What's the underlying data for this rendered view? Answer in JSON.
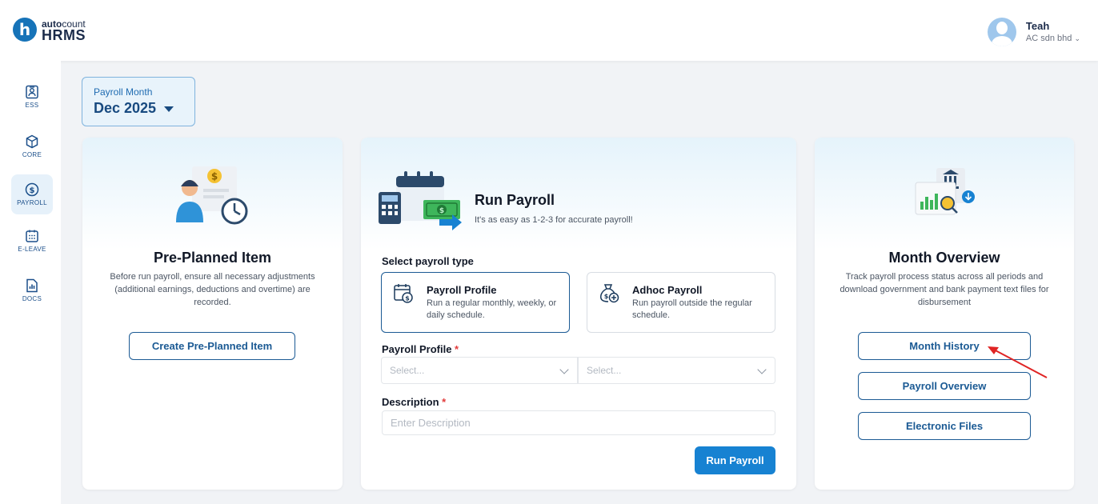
{
  "header": {
    "logo_letter": "h",
    "logo_brand_bold": "auto",
    "logo_brand_thin": "count",
    "logo_product": "HRMS",
    "user_name": "Teah",
    "user_company": "AC sdn bhd"
  },
  "sidebar": {
    "items": [
      {
        "label": "ESS",
        "icon": "person-card-icon"
      },
      {
        "label": "CORE",
        "icon": "cube-icon"
      },
      {
        "label": "PAYROLL",
        "icon": "dollar-circle-icon",
        "active": true
      },
      {
        "label": "E-LEAVE",
        "icon": "calendar-icon"
      },
      {
        "label": "DOCS",
        "icon": "document-chart-icon"
      }
    ]
  },
  "payroll_month": {
    "label": "Payroll Month",
    "value": "Dec 2025"
  },
  "pre_planned": {
    "title": "Pre-Planned Item",
    "description": "Before run payroll, ensure all necessary adjustments (additional earnings, deductions and overtime) are recorded.",
    "button": "Create Pre-Planned Item"
  },
  "run_payroll": {
    "title": "Run Payroll",
    "subtitle": "It's as easy as 1-2-3 for accurate payroll!",
    "select_type_label": "Select payroll type",
    "types": [
      {
        "title": "Payroll Profile",
        "description": "Run a regular monthly, weekly, or daily schedule.",
        "selected": true
      },
      {
        "title": "Adhoc Payroll",
        "description": "Run payroll outside the regular schedule.",
        "selected": false
      }
    ],
    "profile_label": "Payroll Profile",
    "required_mark": "*",
    "select_placeholder_1": "Select...",
    "select_placeholder_2": "Select...",
    "description_label": "Description",
    "description_placeholder": "Enter Description",
    "button": "Run Payroll"
  },
  "month_overview": {
    "title": "Month Overview",
    "description": "Track payroll process status across all periods and download government and bank payment text files for disbursement",
    "buttons": [
      "Month History",
      "Payroll Overview",
      "Electronic Files"
    ]
  },
  "colors": {
    "primary": "#1782d2",
    "navy": "#1b5a94",
    "annotation_arrow": "#e02424"
  }
}
